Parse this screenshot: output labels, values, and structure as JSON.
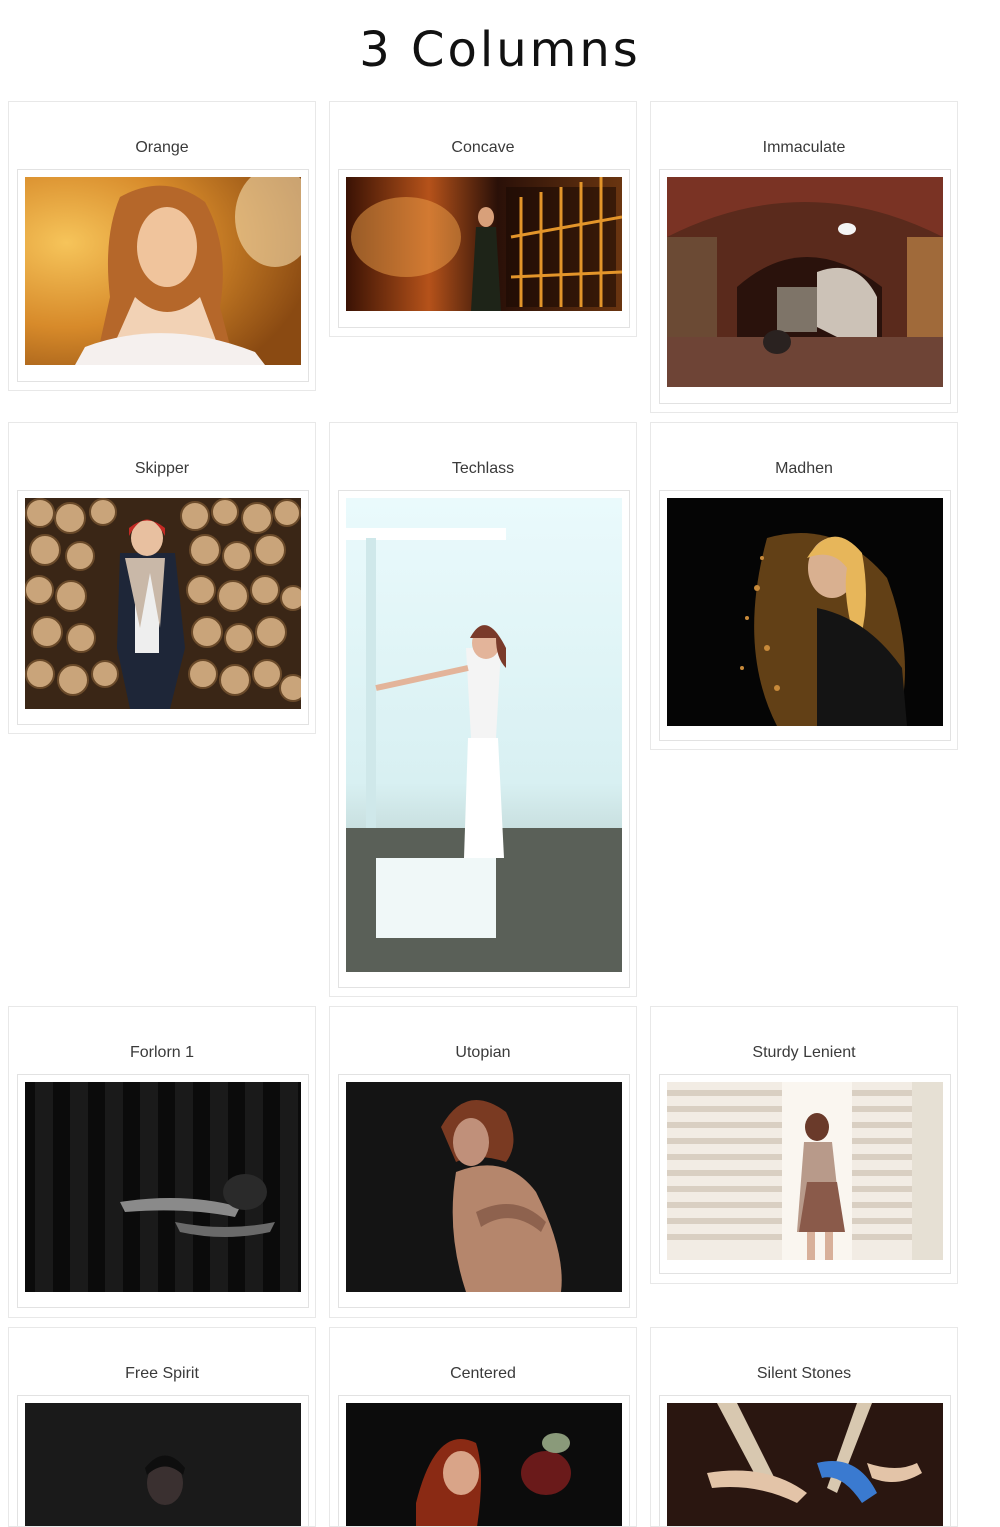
{
  "page": {
    "title": "3 Columns"
  },
  "gallery": {
    "items": [
      {
        "title": "Orange",
        "photo": "woman-golden-light-photo"
      },
      {
        "title": "Concave",
        "photo": "woman-in-corridor-photo"
      },
      {
        "title": "Immaculate",
        "photo": "brick-archway-photo"
      },
      {
        "title": "Skipper",
        "photo": "woman-by-woodpile-photo"
      },
      {
        "title": "Techlass",
        "photo": "woman-white-outfit-photo"
      },
      {
        "title": "Madhen",
        "photo": "woman-gold-dust-photo"
      },
      {
        "title": "Forlorn 1",
        "photo": "figure-dark-wall-photo"
      },
      {
        "title": "Utopian",
        "photo": "woman-dark-portrait-photo"
      },
      {
        "title": "Sturdy Lenient",
        "photo": "woman-window-blinds-photo"
      },
      {
        "title": "Free Spirit",
        "photo": "man-dark-portrait-photo"
      },
      {
        "title": "Centered",
        "photo": "redhead-dark-photo"
      },
      {
        "title": "Silent Stones",
        "photo": "aerial-silks-photo"
      }
    ]
  }
}
